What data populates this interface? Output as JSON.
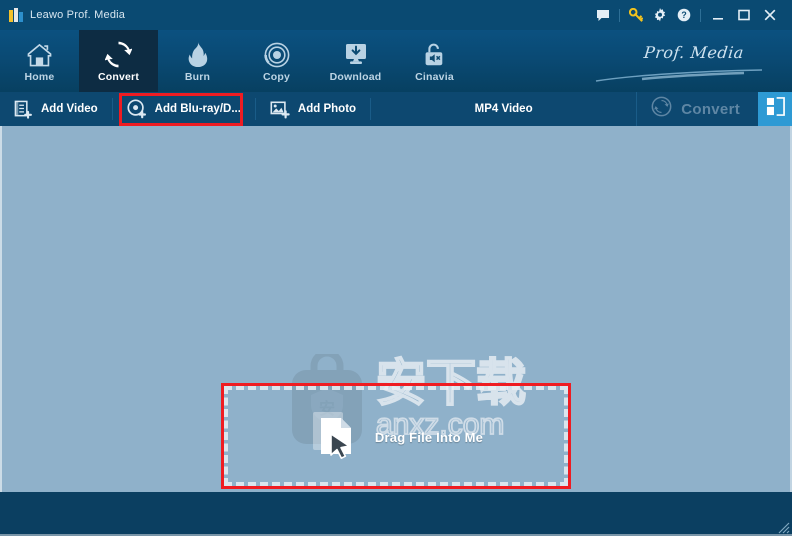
{
  "window": {
    "title": "Leawo Prof. Media",
    "logo_icon": "leawo-logo-icon",
    "controls": {
      "feedback_icon": "chat-bubble-icon",
      "key_icon": "key-icon",
      "settings_icon": "gear-icon",
      "help_icon": "help-circle-icon",
      "minimize_icon": "minimize-icon",
      "maximize_icon": "maximize-icon",
      "close_icon": "close-icon"
    }
  },
  "nav": {
    "items": [
      {
        "label": "Home",
        "icon": "home-icon",
        "active": false
      },
      {
        "label": "Convert",
        "icon": "convert-icon",
        "active": true
      },
      {
        "label": "Burn",
        "icon": "flame-icon",
        "active": false
      },
      {
        "label": "Copy",
        "icon": "disc-icon",
        "active": false
      },
      {
        "label": "Download",
        "icon": "download-icon",
        "active": false
      },
      {
        "label": "Cinavia",
        "icon": "unlock-mute-icon",
        "active": false
      }
    ],
    "brand": "Prof. Media"
  },
  "toolbar": {
    "add_video": {
      "label": "Add Video",
      "icon": "film-plus-icon"
    },
    "add_bluray": {
      "label": "Add Blu-ray/D...",
      "icon": "disc-plus-icon",
      "highlighted": true
    },
    "add_photo": {
      "label": "Add Photo",
      "icon": "photo-plus-icon"
    },
    "format": "MP4 Video",
    "convert": {
      "label": "Convert",
      "icon": "convert-circle-icon",
      "enabled": false
    },
    "panel_toggle_icon": "panel-layout-icon"
  },
  "content": {
    "dropzone": {
      "label": "Drag File Into Me",
      "icon": "file-cursor-icon",
      "highlighted": true
    },
    "watermark": {
      "site": "anxz.com",
      "cn_text": "安下载",
      "badge_char": "安",
      "bag_icon": "shield-bag-icon"
    }
  },
  "status": {
    "resize_grip_icon": "resize-grip-icon"
  },
  "colors": {
    "titlebar": "#0a4a72",
    "nav_gradient_top": "#0b5180",
    "nav_gradient_bottom": "#074061",
    "nav_active": "#0d2c43",
    "toolbar": "#0d4870",
    "content": "#8FB1CA",
    "statusbar": "#0b3f61",
    "accent_blue": "#2e9ad4",
    "highlight_red": "#ef1c22",
    "disabled_text": "#5e86a4"
  }
}
